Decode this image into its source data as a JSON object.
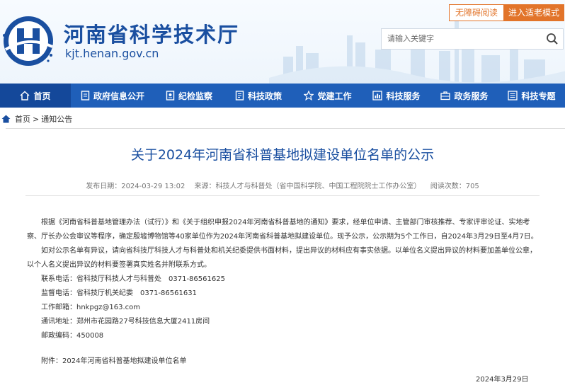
{
  "header": {
    "site_name": "河南省科学技术厅",
    "site_domain": "kjt.henan.gov.cn",
    "accessible_label": "无障碍阅读",
    "elder_label": "进入适老模式",
    "search_placeholder": "请输入关键字"
  },
  "colors": {
    "brand_blue": "#1a4fa0",
    "nav_blue": "#1f5fb9",
    "accent_orange": "#e2742a"
  },
  "nav": {
    "items": [
      {
        "label": "首页",
        "icon": "home-icon"
      },
      {
        "label": "政府信息公开",
        "icon": "document-icon"
      },
      {
        "label": "纪检监察",
        "icon": "inspection-icon"
      },
      {
        "label": "科技政策",
        "icon": "policy-icon"
      },
      {
        "label": "党建工作",
        "icon": "star-icon"
      },
      {
        "label": "科技服务",
        "icon": "chart-icon"
      },
      {
        "label": "政务服务",
        "icon": "briefcase-icon"
      },
      {
        "label": "科技专题",
        "icon": "list-icon"
      }
    ]
  },
  "breadcrumb": {
    "home": "首页",
    "separator": ">",
    "current": "通知公告"
  },
  "article": {
    "title": "关于2024年河南省科普基地拟建设单位名单的公示",
    "publish_date": "发布日期：2024-03-29 13:02",
    "source": "来源：科技人才与科普处（省中国科学院、中国工程院院士工作办公室）",
    "views": "阅读次数：705",
    "para1": "根据《河南省科普基地管理办法（试行）》和《关于组织申报2024年河南省科普基地的通知》要求，经单位申请、主管部门审核推荐、专家评审论证、实地考察、厅长办公会审议等程序，确定殷墟博物馆等40家单位作为2024年河南省科普基地拟建设单位。现予公示，公示期为5个工作日，自2024年3月29日至4月7日。",
    "para2": "如对公示名单有异议，请向省科技厅科技人才与科普处和机关纪委提供书面材料，提出异议的材料应有事实依据。以单位名义提出异议的材料要加盖单位公章，以个人名义提出异议的材料要签署真实姓名并附联系方式。",
    "contact_phone": "联系电话：省科技厅科技人才与科普处　0371-86561625",
    "supervise_phone": "监督电话：省科技厅机关纪委　0371-86561631",
    "email": "工作邮箱：hnkpgz@163.com",
    "address": "通讯地址：郑州市花园路27号科技信息大厦2411房间",
    "postcode": "邮政编码：450008",
    "attachment": "附件：2024年河南省科普基地拟建设单位名单",
    "date": "2024年3月29日"
  }
}
